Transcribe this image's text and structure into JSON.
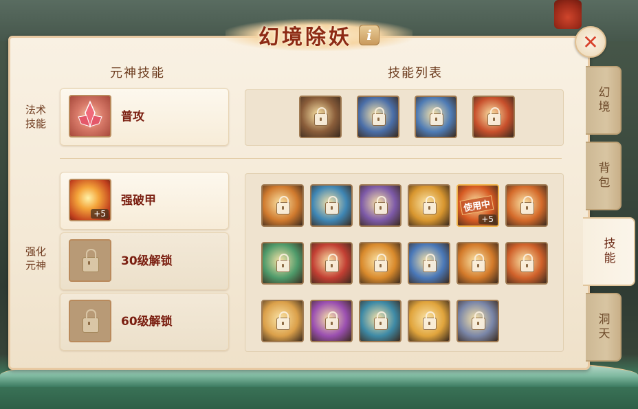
{
  "title": "幻境除妖",
  "info_label": "i",
  "close_label": "✕",
  "left_section_title": "元神技能",
  "right_section_title": "技能列表",
  "side_labels": {
    "magic": "法术技能",
    "enhance": "强化元神"
  },
  "magic_skill": {
    "name": "普攻",
    "icon": "pink-crystal-flower-icon"
  },
  "enhance_skills": [
    {
      "name": "强破甲",
      "icon": "golden-shield-burst-icon",
      "badge": "+5",
      "locked": false
    },
    {
      "name": "30级解锁",
      "icon": "lock-icon",
      "locked": true
    },
    {
      "name": "60级解锁",
      "icon": "lock-icon",
      "locked": true
    }
  ],
  "magic_grid": [
    {
      "icon": "lightning-skill-icon",
      "color": "#8a5d3a"
    },
    {
      "icon": "whirlwind-skill-icon",
      "color": "#4a6ea8"
    },
    {
      "icon": "frost-dragon-skill-icon",
      "color": "#4e7bb5"
    },
    {
      "icon": "fire-demon-skill-icon",
      "color": "#c8502c"
    }
  ],
  "enhance_grid": [
    {
      "icon": "flame-lotus-skill-icon",
      "color": "#d07a2e"
    },
    {
      "icon": "water-vortex-skill-icon",
      "color": "#3f86b4"
    },
    {
      "icon": "violet-swirl-skill-icon",
      "color": "#7d5aa8"
    },
    {
      "icon": "golden-beam-skill-icon",
      "color": "#d8962f"
    },
    {
      "icon": "golden-shield-burst-icon",
      "color": "#d65a22",
      "using": "使用中",
      "badge": "+5"
    },
    {
      "icon": "fire-bloom-skill-icon",
      "color": "#d46a2a"
    },
    {
      "icon": "jade-lotus-skill-icon",
      "color": "#4e9a6a"
    },
    {
      "icon": "red-orb-skill-icon",
      "color": "#c23f33"
    },
    {
      "icon": "amber-wave-skill-icon",
      "color": "#d98a2c"
    },
    {
      "icon": "blue-burst-skill-icon",
      "color": "#4a78b8"
    },
    {
      "icon": "orange-swirl-skill-icon",
      "color": "#d37a2a"
    },
    {
      "icon": "ember-flower-skill-icon",
      "color": "#d0612a"
    },
    {
      "icon": "sun-ring-skill-icon",
      "color": "#dba04a"
    },
    {
      "icon": "purple-flare-skill-icon",
      "color": "#9a4fb0"
    },
    {
      "icon": "teal-vortex-skill-icon",
      "color": "#3e8aa6"
    },
    {
      "icon": "starburst-skill-icon",
      "color": "#e0a43c"
    },
    {
      "icon": "silver-tornado-skill-icon",
      "color": "#7a86a8"
    }
  ],
  "tabs": [
    {
      "label": "幻境",
      "active": false
    },
    {
      "label": "背包",
      "active": false
    },
    {
      "label": "技能",
      "active": true
    },
    {
      "label": "洞天",
      "active": false
    }
  ]
}
